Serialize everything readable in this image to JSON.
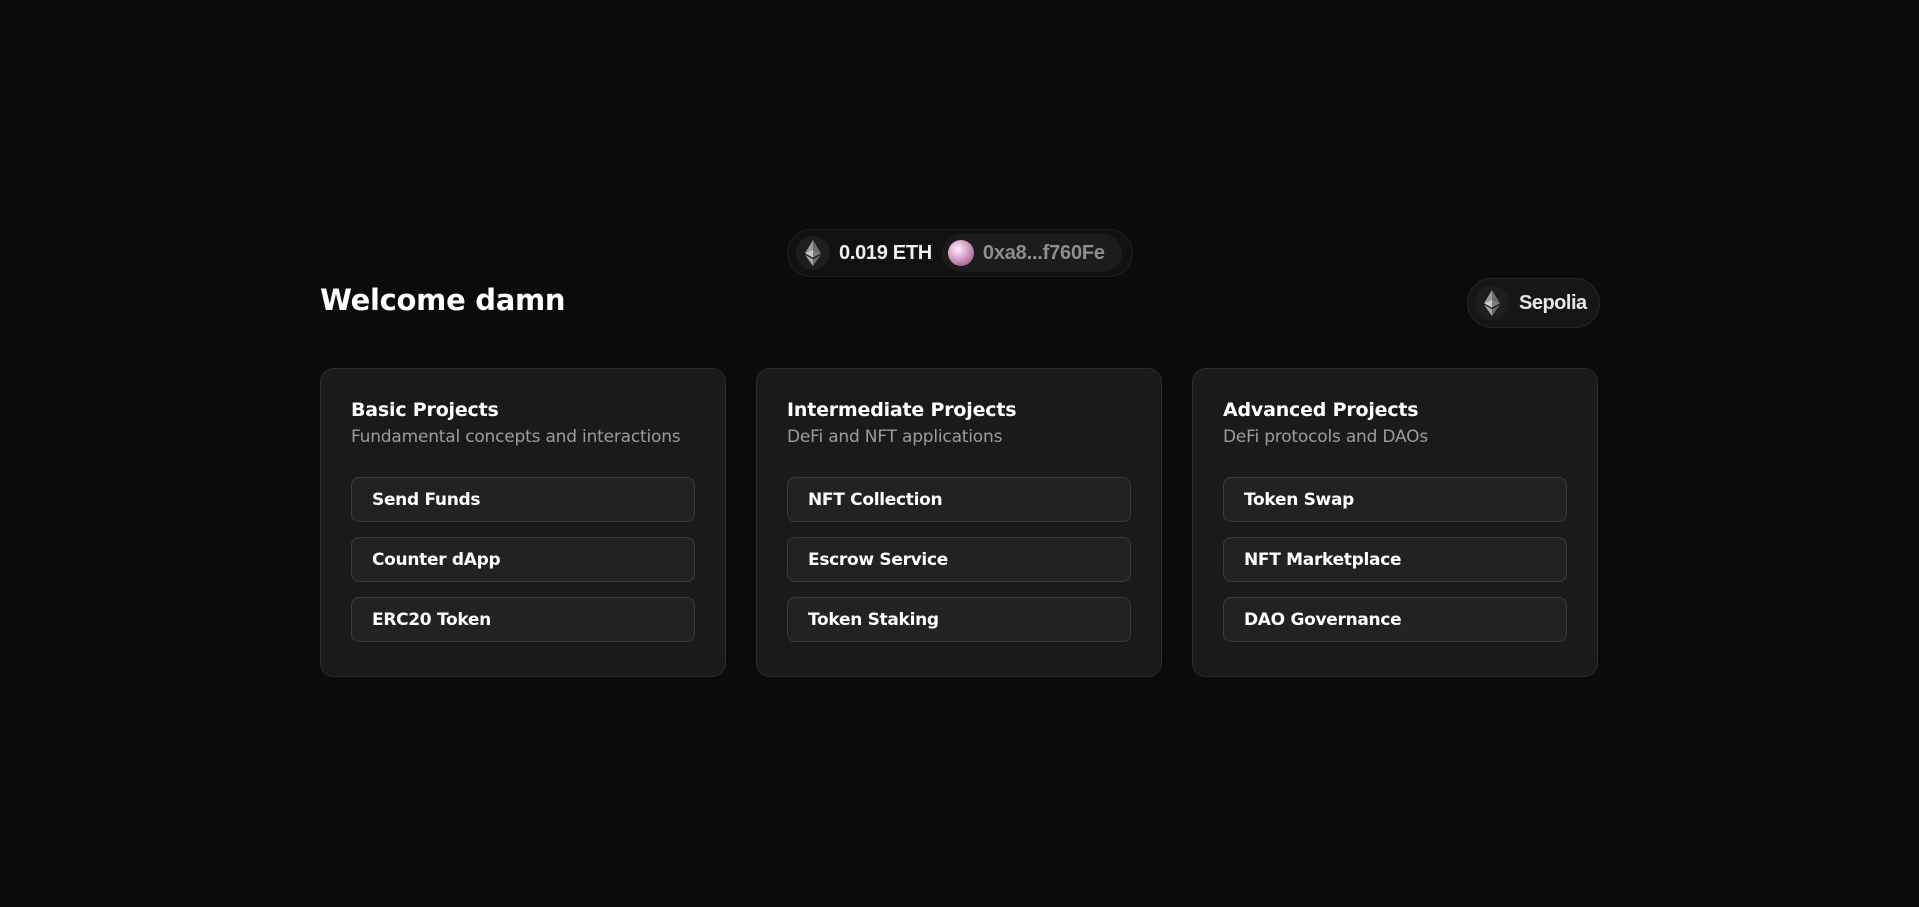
{
  "wallet": {
    "balance": "0.019 ETH",
    "address": "0xa8...f760Fe",
    "eth_icon": "ethereum-diamond-icon",
    "avatar_icon": "pink-sphere-avatar"
  },
  "header": {
    "welcome": "Welcome damn",
    "network_label": "Sepolia",
    "network_icon": "ethereum-diamond-icon"
  },
  "cards": [
    {
      "title": "Basic Projects",
      "description": "Fundamental concepts and interactions",
      "buttons": [
        "Send Funds",
        "Counter dApp",
        "ERC20 Token"
      ]
    },
    {
      "title": "Intermediate Projects",
      "description": "DeFi and NFT applications",
      "buttons": [
        "NFT Collection",
        "Escrow Service",
        "Token Staking"
      ]
    },
    {
      "title": "Advanced Projects",
      "description": "DeFi protocols and DAOs",
      "buttons": [
        "Token Swap",
        "NFT Marketplace",
        "DAO Governance"
      ]
    }
  ],
  "colors": {
    "background": "#0b0b0b",
    "card_bg": "#1a1a1a",
    "button_bg": "#222222",
    "muted_text": "#9c9c9c",
    "address_text": "#8e8e8e"
  }
}
